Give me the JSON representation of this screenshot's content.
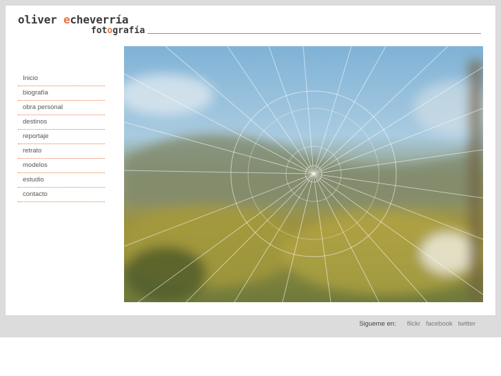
{
  "logo": {
    "name_part1": "oliver ",
    "name_e": "e",
    "name_part2": "cheverría",
    "sub_part1": "fot",
    "sub_o": "o",
    "sub_part2": "grafía"
  },
  "nav": {
    "items": [
      {
        "label": "Inicio"
      },
      {
        "label": "biografía"
      },
      {
        "label": "obra personal"
      },
      {
        "label": "destinos"
      },
      {
        "label": "reportaje"
      },
      {
        "label": "retrato"
      },
      {
        "label": "modelos"
      },
      {
        "label": "estudio"
      },
      {
        "label": "contacto"
      }
    ]
  },
  "photo": {
    "icon": "broken-glass-photo"
  },
  "footer": {
    "follow_label": "Sigueme en:",
    "links": [
      {
        "label": "flickr"
      },
      {
        "label": "facebook"
      },
      {
        "label": "twitter"
      }
    ]
  },
  "colors": {
    "accent": "#e8743b",
    "background": "#dcdcdc"
  }
}
